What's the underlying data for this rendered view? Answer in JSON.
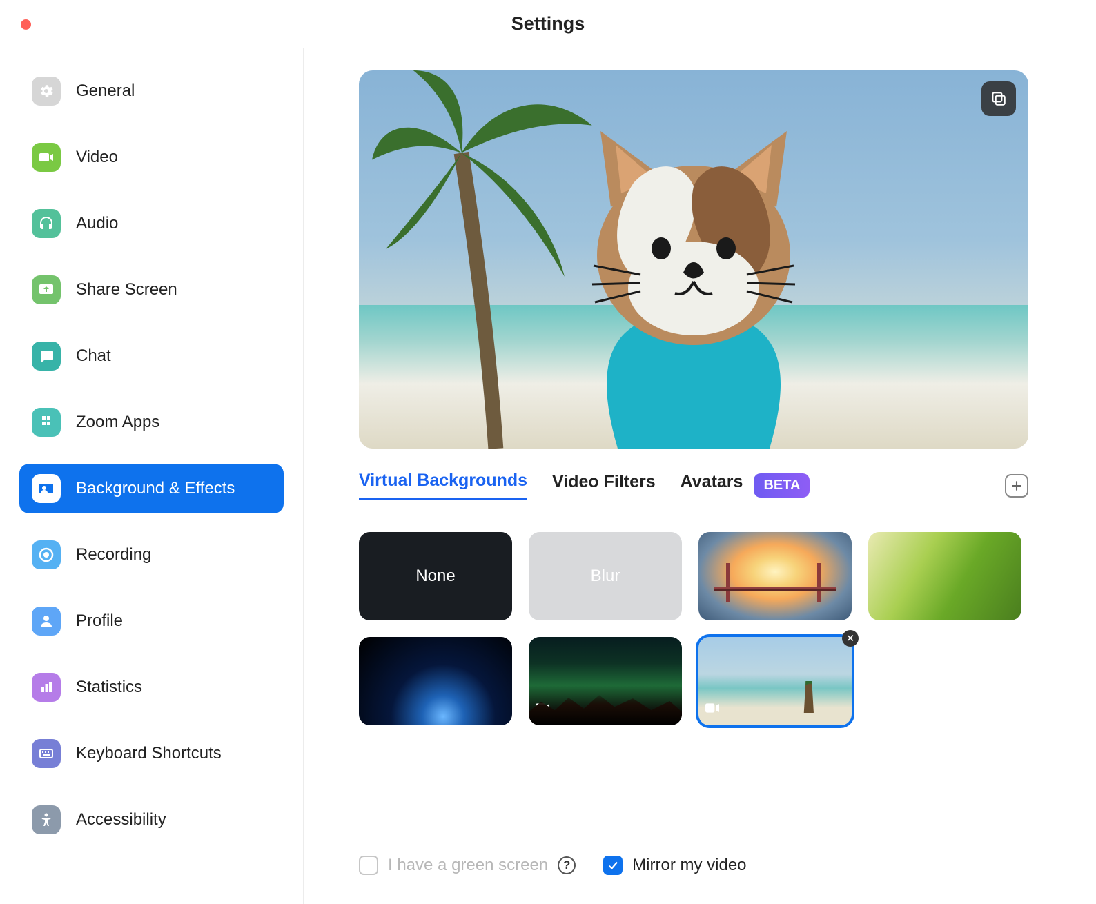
{
  "window": {
    "title": "Settings"
  },
  "sidebar": {
    "items": [
      {
        "label": "General"
      },
      {
        "label": "Video"
      },
      {
        "label": "Audio"
      },
      {
        "label": "Share Screen"
      },
      {
        "label": "Chat"
      },
      {
        "label": "Zoom Apps"
      },
      {
        "label": "Background & Effects"
      },
      {
        "label": "Recording"
      },
      {
        "label": "Profile"
      },
      {
        "label": "Statistics"
      },
      {
        "label": "Keyboard Shortcuts"
      },
      {
        "label": "Accessibility"
      }
    ]
  },
  "tabs": {
    "virtual_backgrounds": "Virtual Backgrounds",
    "video_filters": "Video Filters",
    "avatars": "Avatars",
    "beta": "BETA"
  },
  "backgrounds": {
    "none": "None",
    "blur": "Blur"
  },
  "footer": {
    "green_screen": "I have a green screen",
    "mirror": "Mirror my video"
  }
}
